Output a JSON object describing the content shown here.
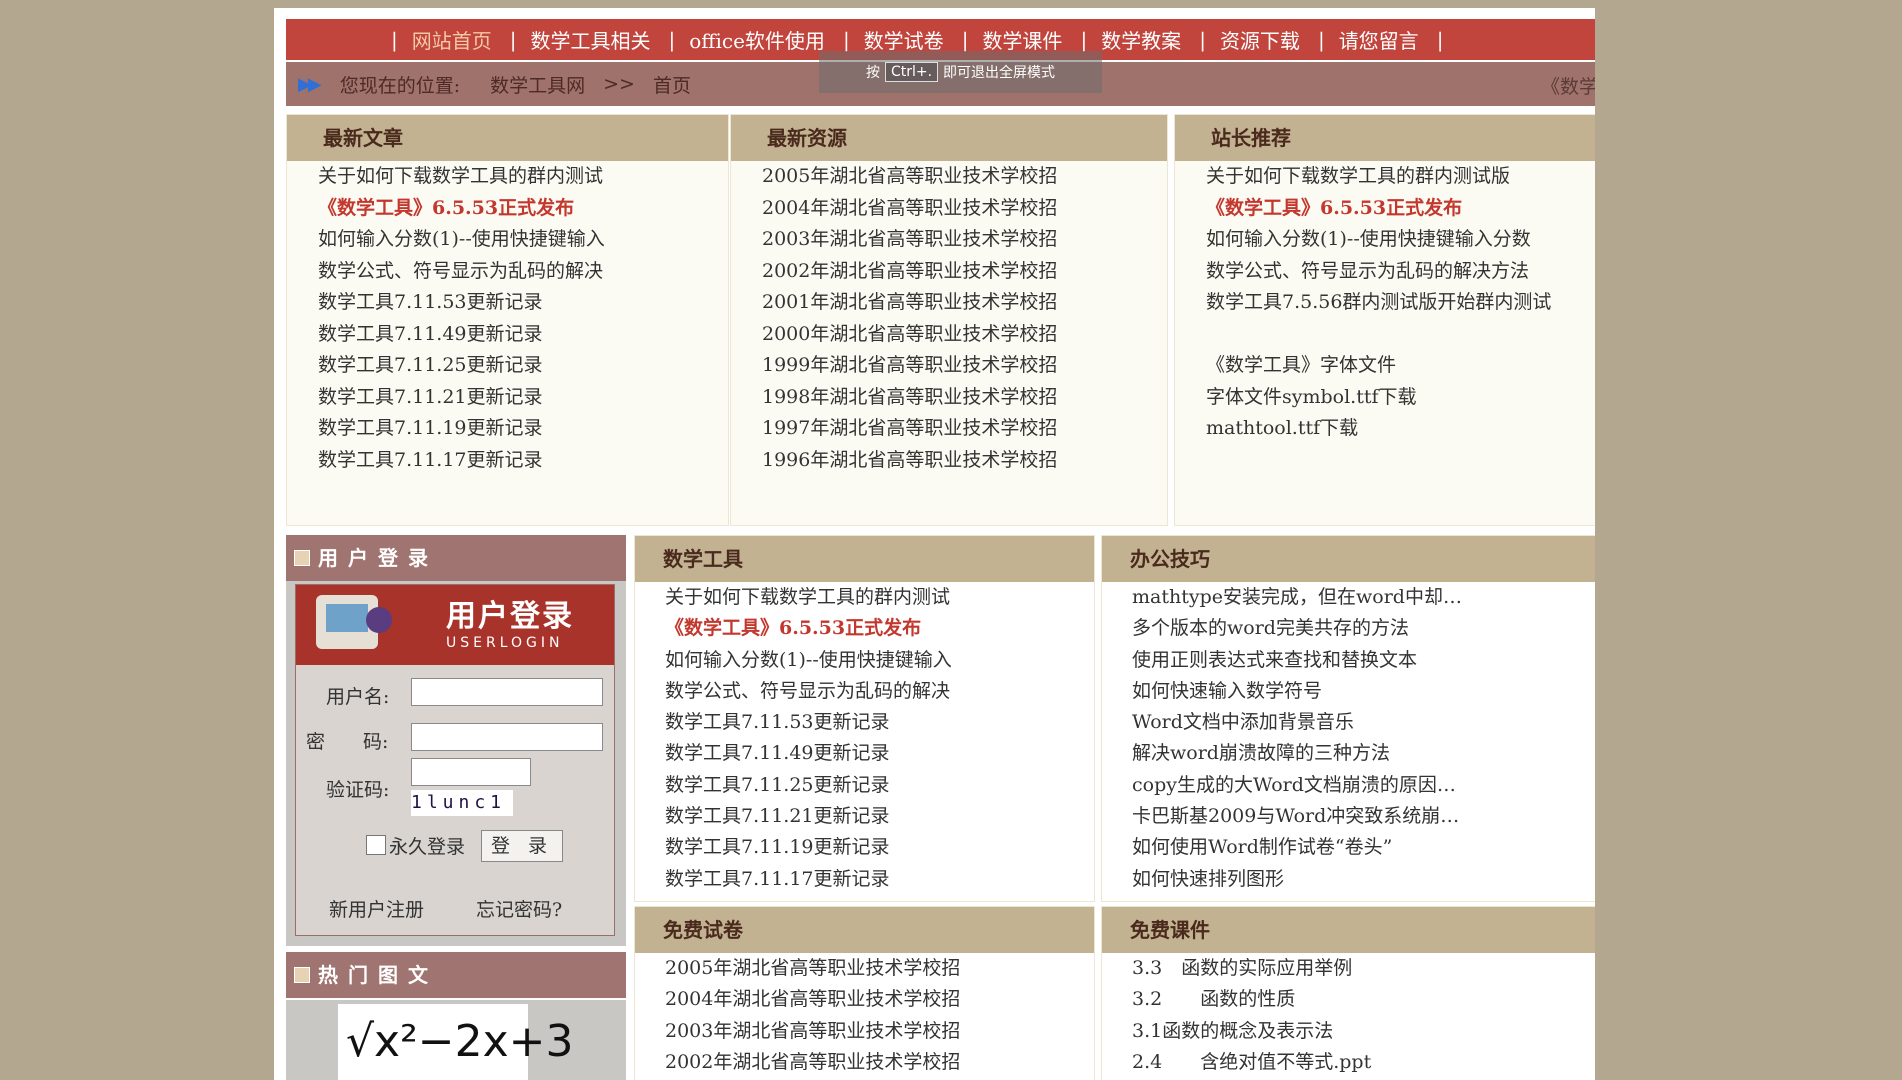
{
  "nav": {
    "items": [
      "网站首页",
      "数学工具相关",
      "office软件使用",
      "数学试卷",
      "数学课件",
      "数学教案",
      "资源下载",
      "请您留言"
    ]
  },
  "breadcrumb": {
    "label": "您现在的位置:",
    "site": "数学工具网",
    "page": "首页",
    "marquee": "《数学工"
  },
  "fullscreen_hint": {
    "prefix": "按",
    "key": "Ctrl+.",
    "suffix": "即可退出全屏模式"
  },
  "latest_articles": {
    "title": "最新文章",
    "items": [
      "关于如何下载数学工具的群内测试",
      "《数学工具》6.5.53正式发布",
      "如何输入分数(1)--使用快捷键输入",
      "数学公式、符号显示为乱码的解决",
      "数学工具7.11.53更新记录",
      "数学工具7.11.49更新记录",
      "数学工具7.11.25更新记录",
      "数学工具7.11.21更新记录",
      "数学工具7.11.19更新记录",
      "数学工具7.11.17更新记录"
    ]
  },
  "latest_resources": {
    "title": "最新资源",
    "items": [
      "2005年湖北省高等职业技术学校招",
      "2004年湖北省高等职业技术学校招",
      "2003年湖北省高等职业技术学校招",
      "2002年湖北省高等职业技术学校招",
      "2001年湖北省高等职业技术学校招",
      "2000年湖北省高等职业技术学校招",
      "1999年湖北省高等职业技术学校招",
      "1998年湖北省高等职业技术学校招",
      "1997年湖北省高等职业技术学校招",
      "1996年湖北省高等职业技术学校招"
    ]
  },
  "recommend": {
    "title": "站长推荐",
    "items": [
      "关于如何下载数学工具的群内测试版",
      "《数学工具》6.5.53正式发布",
      "如何输入分数(1)--使用快捷键输入分数",
      "数学公式、符号显示为乱码的解决方法",
      "数学工具7.5.56群内测试版开始群内测试",
      "《数学工具》字体文件",
      "字体文件symbol.ttf下载",
      "mathtool.ttf下载"
    ]
  },
  "login": {
    "title": "用户登录",
    "banner_cn": "用户登录",
    "banner_en": "USERLOGIN",
    "username_label": "用户名:",
    "password_label": "密　　码:",
    "captcha_label": "验证码:",
    "captcha_text": "1lunc1",
    "remember": "永久登录",
    "submit": "登 录",
    "register": "新用户注册",
    "forgot": "忘记密码?"
  },
  "hot": {
    "title": "热门图文",
    "formula": "√x²−2x+3"
  },
  "math_tools": {
    "title": "数学工具",
    "items": [
      "关于如何下载数学工具的群内测试",
      "《数学工具》6.5.53正式发布",
      "如何输入分数(1)--使用快捷键输入",
      "数学公式、符号显示为乱码的解决",
      "数学工具7.11.53更新记录",
      "数学工具7.11.49更新记录",
      "数学工具7.11.25更新记录",
      "数学工具7.11.21更新记录",
      "数学工具7.11.19更新记录",
      "数学工具7.11.17更新记录"
    ]
  },
  "office_tips": {
    "title": "办公技巧",
    "items": [
      "mathtype安装完成，但在word中却…",
      "多个版本的word完美共存的方法",
      "使用正则表达式来查找和替换文本",
      "如何快速输入数学符号",
      "Word文档中添加背景音乐",
      "解决word崩溃故障的三种方法",
      "copy生成的大Word文档崩溃的原因…",
      "卡巴斯基2009与Word冲突致系统崩…",
      "如何使用Word制作试卷“卷头”",
      "如何快速排列图形"
    ]
  },
  "free_papers": {
    "title": "免费试卷",
    "items": [
      "2005年湖北省高等职业技术学校招",
      "2004年湖北省高等职业技术学校招",
      "2003年湖北省高等职业技术学校招",
      "2002年湖北省高等职业技术学校招"
    ]
  },
  "free_courseware": {
    "title": "免费课件",
    "items": [
      "3.3　函数的实际应用举例",
      "3.2　　函数的性质",
      "3.1函数的概念及表示法",
      "2.4　　含绝对值不等式.ppt"
    ]
  }
}
